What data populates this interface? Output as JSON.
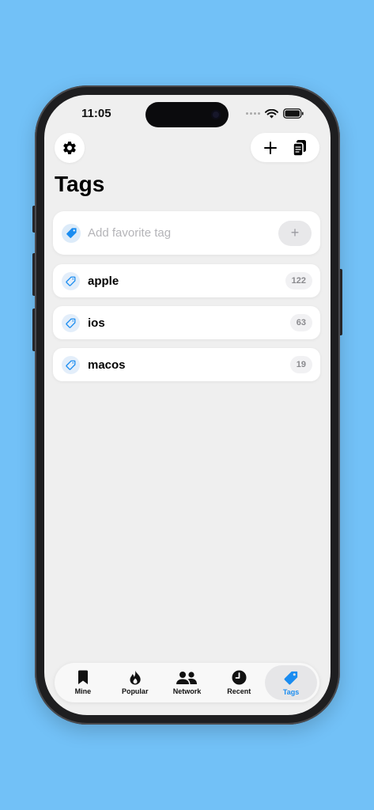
{
  "status_bar": {
    "time": "11:05"
  },
  "header": {
    "title": "Tags"
  },
  "icons": {
    "settings": "gear-icon",
    "add": "plus-icon",
    "copy": "copy-icon",
    "tag": "tag-icon"
  },
  "add_tag": {
    "placeholder": "Add favorite tag",
    "value": "",
    "button_label": "+"
  },
  "tags": [
    {
      "name": "apple",
      "count": "122"
    },
    {
      "name": "ios",
      "count": "63"
    },
    {
      "name": "macos",
      "count": "19"
    }
  ],
  "tabs": [
    {
      "label": "Mine",
      "icon": "bookmark-icon",
      "active": false
    },
    {
      "label": "Popular",
      "icon": "flame-icon",
      "active": false
    },
    {
      "label": "Network",
      "icon": "people-icon",
      "active": false
    },
    {
      "label": "Recent",
      "icon": "clock-icon",
      "active": false
    },
    {
      "label": "Tags",
      "icon": "tag-icon",
      "active": true
    }
  ],
  "colors": {
    "background": "#72c1f7",
    "accent": "#1a8cf0",
    "screen": "#efefef",
    "card": "#ffffff"
  }
}
